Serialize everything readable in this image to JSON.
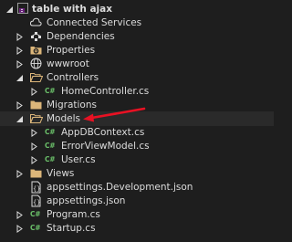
{
  "project": {
    "label": "table with ajax"
  },
  "items": {
    "connected_services": "Connected Services",
    "dependencies": "Dependencies",
    "properties": "Properties",
    "wwwroot": "wwwroot",
    "controllers": "Controllers",
    "home_controller": "HomeController.cs",
    "migrations": "Migrations",
    "models": "Models",
    "app_db_context": "AppDBContext.cs",
    "error_view_model": "ErrorViewModel.cs",
    "user": "User.cs",
    "views": "Views",
    "appsettings_dev": "appsettings.Development.json",
    "appsettings": "appsettings.json",
    "program": "Program.cs",
    "startup": "Startup.cs"
  },
  "cs_glyph": "C#",
  "colors": {
    "background": "#1e1e1e",
    "text": "#dcdcdc",
    "folder": "#dcb67a",
    "csharp": "#6abf69",
    "arrow": "#e81123"
  }
}
